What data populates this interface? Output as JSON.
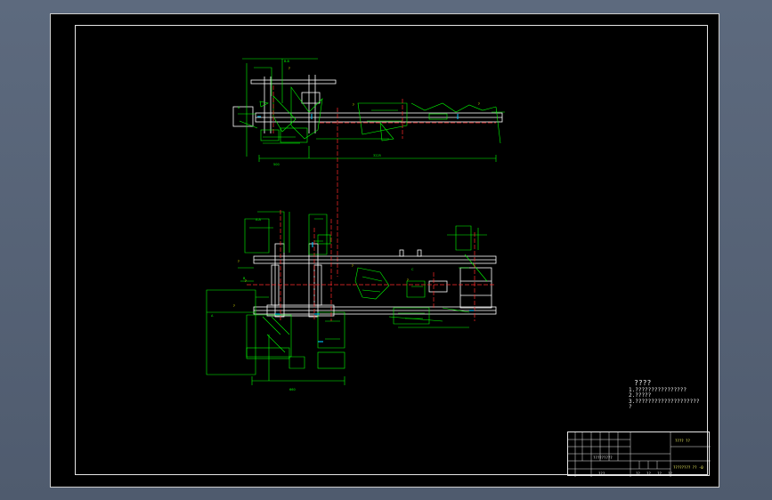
{
  "notes": {
    "title": "????",
    "lines": [
      "1.????????????????",
      "2.?????",
      "3.????????????????????",
      "?"
    ]
  },
  "title_block": {
    "drawing_name": "???? ??",
    "drawing_number": "???????? ?? -0",
    "cells": [
      "?????????",
      "??   ??   ??   ??",
      "???"
    ]
  },
  "colors": {
    "background": "#000000",
    "geometry": "#ffffff",
    "dimensions": "#00ff00",
    "centerlines": "#ff2a2a",
    "labels": "#ffff00",
    "accent_parts": "#00c8ff",
    "viewport_chrome": "#55627a"
  }
}
